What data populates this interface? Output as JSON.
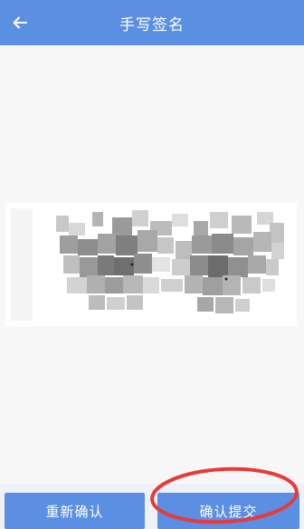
{
  "header": {
    "back_icon": "arrow-left-icon",
    "title": "手写签名"
  },
  "signature": {
    "state": "signed"
  },
  "footer": {
    "redo_label": "重新确认",
    "confirm_label": "确认提交"
  },
  "colors": {
    "primary": "#5b8fe3",
    "annotation": "#e83a3a"
  }
}
